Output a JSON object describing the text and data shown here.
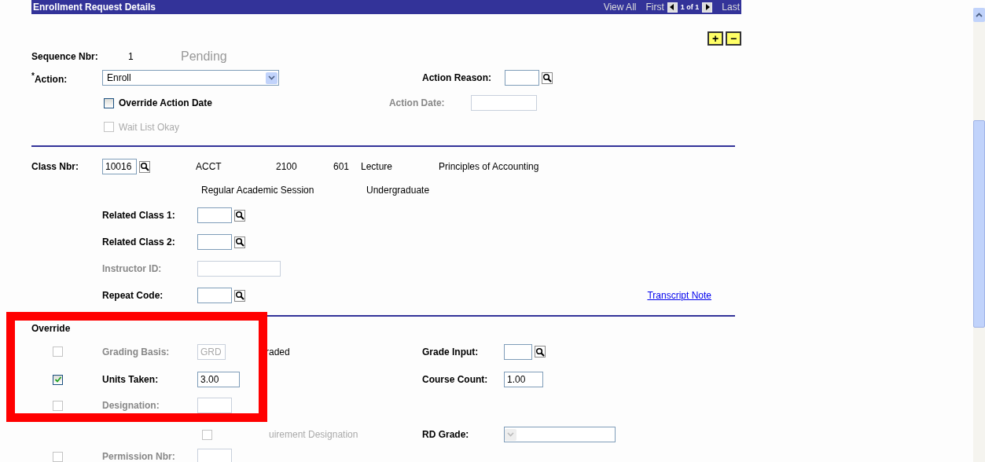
{
  "header": {
    "title": "Enrollment Request Details",
    "view_all": "View All",
    "first": "First",
    "page": "1 of 1",
    "last": "Last"
  },
  "row_buttons": [
    "+",
    "−"
  ],
  "sequence": {
    "label": "Sequence Nbr:",
    "value": "1",
    "status": "Pending"
  },
  "action": {
    "label": "$^{*}$Action:",
    "value": "Enroll"
  },
  "action_reason": {
    "label": "Action Reason:"
  },
  "action_date": {
    "label": "Action Date:",
    "disabled": true
  },
  "checkboxes": [
    {
      "label": "Override Action Date",
      "checked": false,
      "disabled": false
    },
    {
      "label": "Wait List Okay",
      "checked": false,
      "disabled": true
    }
  ],
  "class": {
    "label": "Class Nbr:",
    "value": "10016",
    "details": [
      "ACCT",
      "2100",
      "601",
      "Lecture",
      "Principles of Accounting"
    ],
    "details_2": [
      "Regular Academic Session",
      "Undergraduate"
    ]
  },
  "related_fields": [
    {
      "label": "Related Class 1:",
      "kind": "lookup",
      "disabled": false
    },
    {
      "label": "Related Class 2:",
      "kind": "lookup",
      "disabled": false
    },
    {
      "label": "Instructor ID:",
      "kind": "text",
      "disabled": true
    },
    {
      "label": "Repeat Code:",
      "kind": "lookup",
      "disabled": false
    }
  ],
  "transcript_link": "Transcript Note",
  "override": {
    "heading": "Override",
    "rows": [
      {
        "label": "Grading Basis:",
        "checked": false,
        "disabled": true,
        "value": "GRD",
        "note": "raded"
      },
      {
        "label": "Units Taken:",
        "checked": true,
        "disabled": false,
        "value": "3.00"
      },
      {
        "label": "Designation:",
        "checked": false,
        "disabled": true
      },
      {
        "label": "Permission Nbr:",
        "checked": false,
        "disabled": true
      }
    ]
  },
  "requirement": {
    "label": "uirement Designation",
    "checked": false,
    "disabled": true
  },
  "right_fields": [
    {
      "label": "Grade Input:",
      "kind": "lookup",
      "disabled": false
    },
    {
      "label": "Course Count:",
      "kind": "text",
      "value": "1.00",
      "disabled": false
    },
    {
      "label": "RD Grade:",
      "kind": "select",
      "disabled": true
    }
  ]
}
